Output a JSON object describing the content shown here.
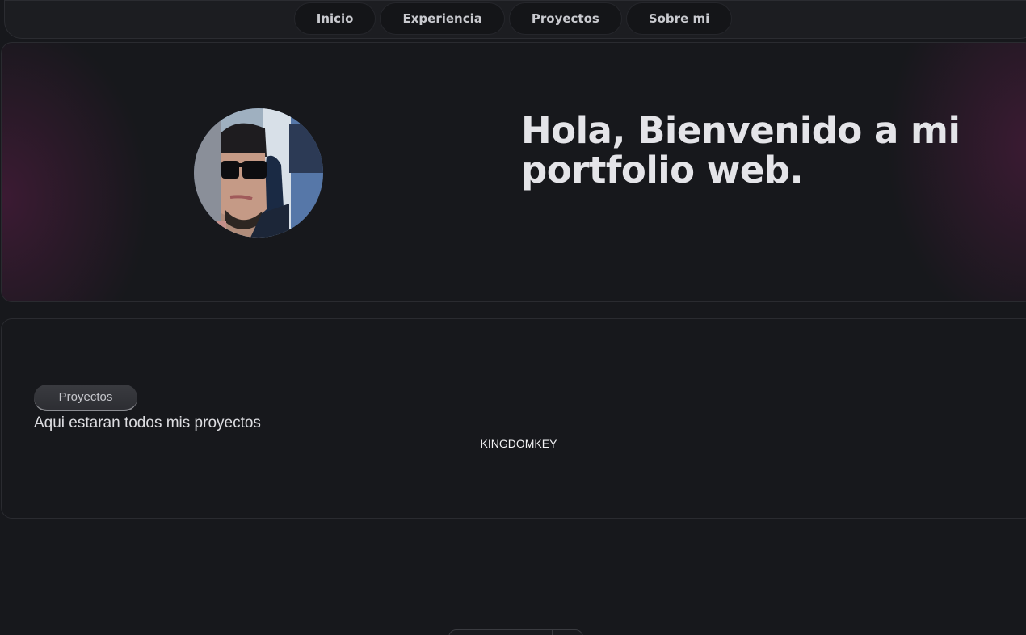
{
  "nav": {
    "items": [
      {
        "label": "Inicio"
      },
      {
        "label": "Experiencia"
      },
      {
        "label": "Proyectos"
      },
      {
        "label": "Sobre mi"
      }
    ]
  },
  "hero": {
    "title": "Hola, Bienvenido a mi portfolio web."
  },
  "projects": {
    "badge": "Proyectos",
    "description": "Aqui estaran todos mis proyectos",
    "items": [
      {
        "name": "KINGDOMKEY"
      }
    ]
  },
  "colors": {
    "background": "#17181c",
    "accent_glow": "#5a1c46",
    "text": "#e4e4e8"
  }
}
